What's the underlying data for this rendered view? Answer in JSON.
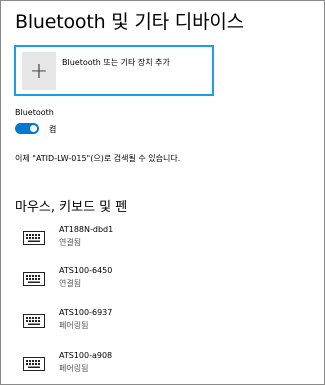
{
  "page": {
    "title": "Bluetooth 및 기타 디바이스"
  },
  "add_device": {
    "icon": "plus-icon",
    "symbol": "+",
    "label": "Bluetooth 또는 기타 장치 추가"
  },
  "bluetooth": {
    "label": "Bluetooth",
    "toggle_state": "켬",
    "toggle_on": true,
    "accent_color": "#0078d4",
    "discoverable_text": "이제 \"ATID-LW-015\"(으)로 검색될 수 있습니다."
  },
  "section": {
    "heading": "마우스, 키보드 및 펜"
  },
  "devices": [
    {
      "icon": "keyboard-icon",
      "name": "AT188N-dbd1",
      "status": "연결됨"
    },
    {
      "icon": "keyboard-icon",
      "name": "ATS100-6450",
      "status": "연결됨"
    },
    {
      "icon": "keyboard-icon",
      "name": "ATS100-6937",
      "status": "페어링됨"
    },
    {
      "icon": "keyboard-icon",
      "name": "ATS100-a908",
      "status": "페어링됨"
    }
  ],
  "colors": {
    "focus_border": "#1a9ee6",
    "tile_background": "#e6e6e6"
  }
}
